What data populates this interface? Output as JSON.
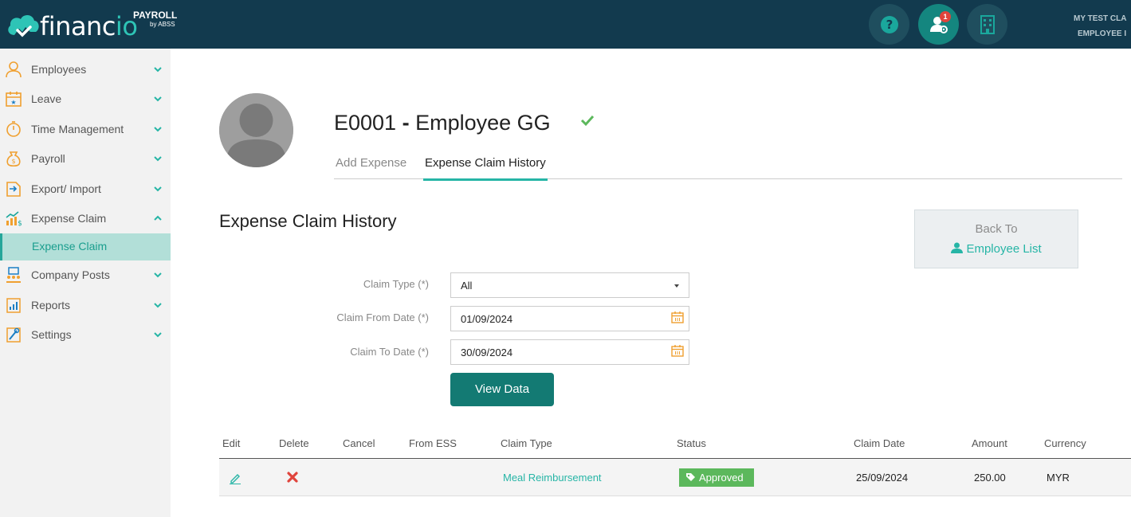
{
  "app": {
    "brand_prefix": "financ",
    "brand_suffix": "io",
    "product": "PAYROLL",
    "by": "by ABSS",
    "notification_count": "1",
    "company_line1": "MY TEST CLA",
    "company_line2": "EMPLOYEE I"
  },
  "sidebar": {
    "items": [
      {
        "label": "Employees",
        "icon": "user-icon"
      },
      {
        "label": "Leave",
        "icon": "calendar-star-icon"
      },
      {
        "label": "Time Management",
        "icon": "stopwatch-icon"
      },
      {
        "label": "Payroll",
        "icon": "money-bag-icon"
      },
      {
        "label": "Export/ Import",
        "icon": "export-import-icon"
      },
      {
        "label": "Expense Claim",
        "icon": "expense-chart-icon"
      },
      {
        "label": "Company Posts",
        "icon": "people-board-icon"
      },
      {
        "label": "Reports",
        "icon": "report-chart-icon"
      },
      {
        "label": "Settings",
        "icon": "settings-tools-icon"
      }
    ],
    "sub_item": "Expense Claim"
  },
  "employee": {
    "code": "E0001",
    "separator": "-",
    "name": "Employee GG"
  },
  "tabs": {
    "add": "Add Expense",
    "history": "Expense Claim History"
  },
  "section_title": "Expense Claim History",
  "back": {
    "line1": "Back To",
    "line2": "Employee List"
  },
  "filters": {
    "claim_type_label": "Claim Type (*)",
    "claim_type_value": "All",
    "from_label": "Claim From Date (*)",
    "from_value": "01/09/2024",
    "to_label": "Claim To Date (*)",
    "to_value": "30/09/2024",
    "view_button": "View Data"
  },
  "table": {
    "headers": [
      "Edit",
      "Delete",
      "Cancel",
      "From ESS",
      "Claim Type",
      "Status",
      "Claim Date",
      "Amount",
      "Currency"
    ],
    "rows": [
      {
        "claim_type": "Meal Reimbursement",
        "status": "Approved",
        "claim_date": "25/09/2024",
        "amount": "250.00",
        "currency": "MYR"
      }
    ]
  },
  "colors": {
    "topbar": "#123a4e",
    "accent": "#26b5a6",
    "primary_button": "#137a73",
    "approved": "#5cb85c",
    "delete": "#e0443c",
    "icon_orange": "#f0a030"
  }
}
